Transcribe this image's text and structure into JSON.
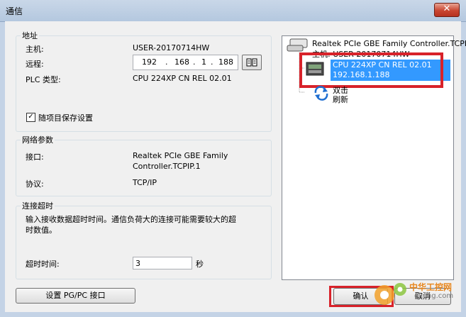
{
  "window": {
    "title": "通信",
    "close_glyph": "✕"
  },
  "address": {
    "legend": "地址",
    "host_label": "主机:",
    "host_value": "USER-20170714HW",
    "remote_label": "远程:",
    "ip_segments": [
      "192",
      "168",
      "1",
      "188"
    ],
    "ip_dot": ".",
    "plc_type_label": "PLC 类型:",
    "plc_type_value": "CPU 224XP CN REL 02.01",
    "save_with_project_label": "随项目保存设置",
    "save_with_project_checked": true,
    "check_glyph": "✓",
    "book_icon": "book-icon"
  },
  "network": {
    "legend": "网络参数",
    "interface_label": "接口:",
    "interface_value_line1": "Realtek PCIe GBE Family",
    "interface_value_line2": "Controller.TCPIP.1",
    "protocol_label": "协议:",
    "protocol_value": "TCP/IP"
  },
  "timeout": {
    "legend": "连接超时",
    "description_line1": "输入接收数据超时时间。通信负荷大的连接可能需要较大的超",
    "description_line2": "时数值。",
    "timeout_label": "超时时间:",
    "timeout_value": "3",
    "unit": "秒"
  },
  "buttons": {
    "set_pgpc": "设置 PG/PC 接口",
    "ok": "确认",
    "cancel": "取消"
  },
  "tree": {
    "adapter": "Realtek PCIe GBE Family Controller.TCPI",
    "host_item": "主机: USER-20170714HW",
    "plc_line1": "CPU 224XP CN REL 02.01",
    "plc_line2": "192.168.1.188",
    "dbl_click_line1": "双击",
    "dbl_click_line2": "刷新"
  },
  "watermark": {
    "text_cn": "中华工控网",
    "text_url": "gkong.com"
  },
  "colors": {
    "selection": "#3399ff",
    "highlight_box": "#d8222a",
    "title_bar": "#b4c8df"
  }
}
